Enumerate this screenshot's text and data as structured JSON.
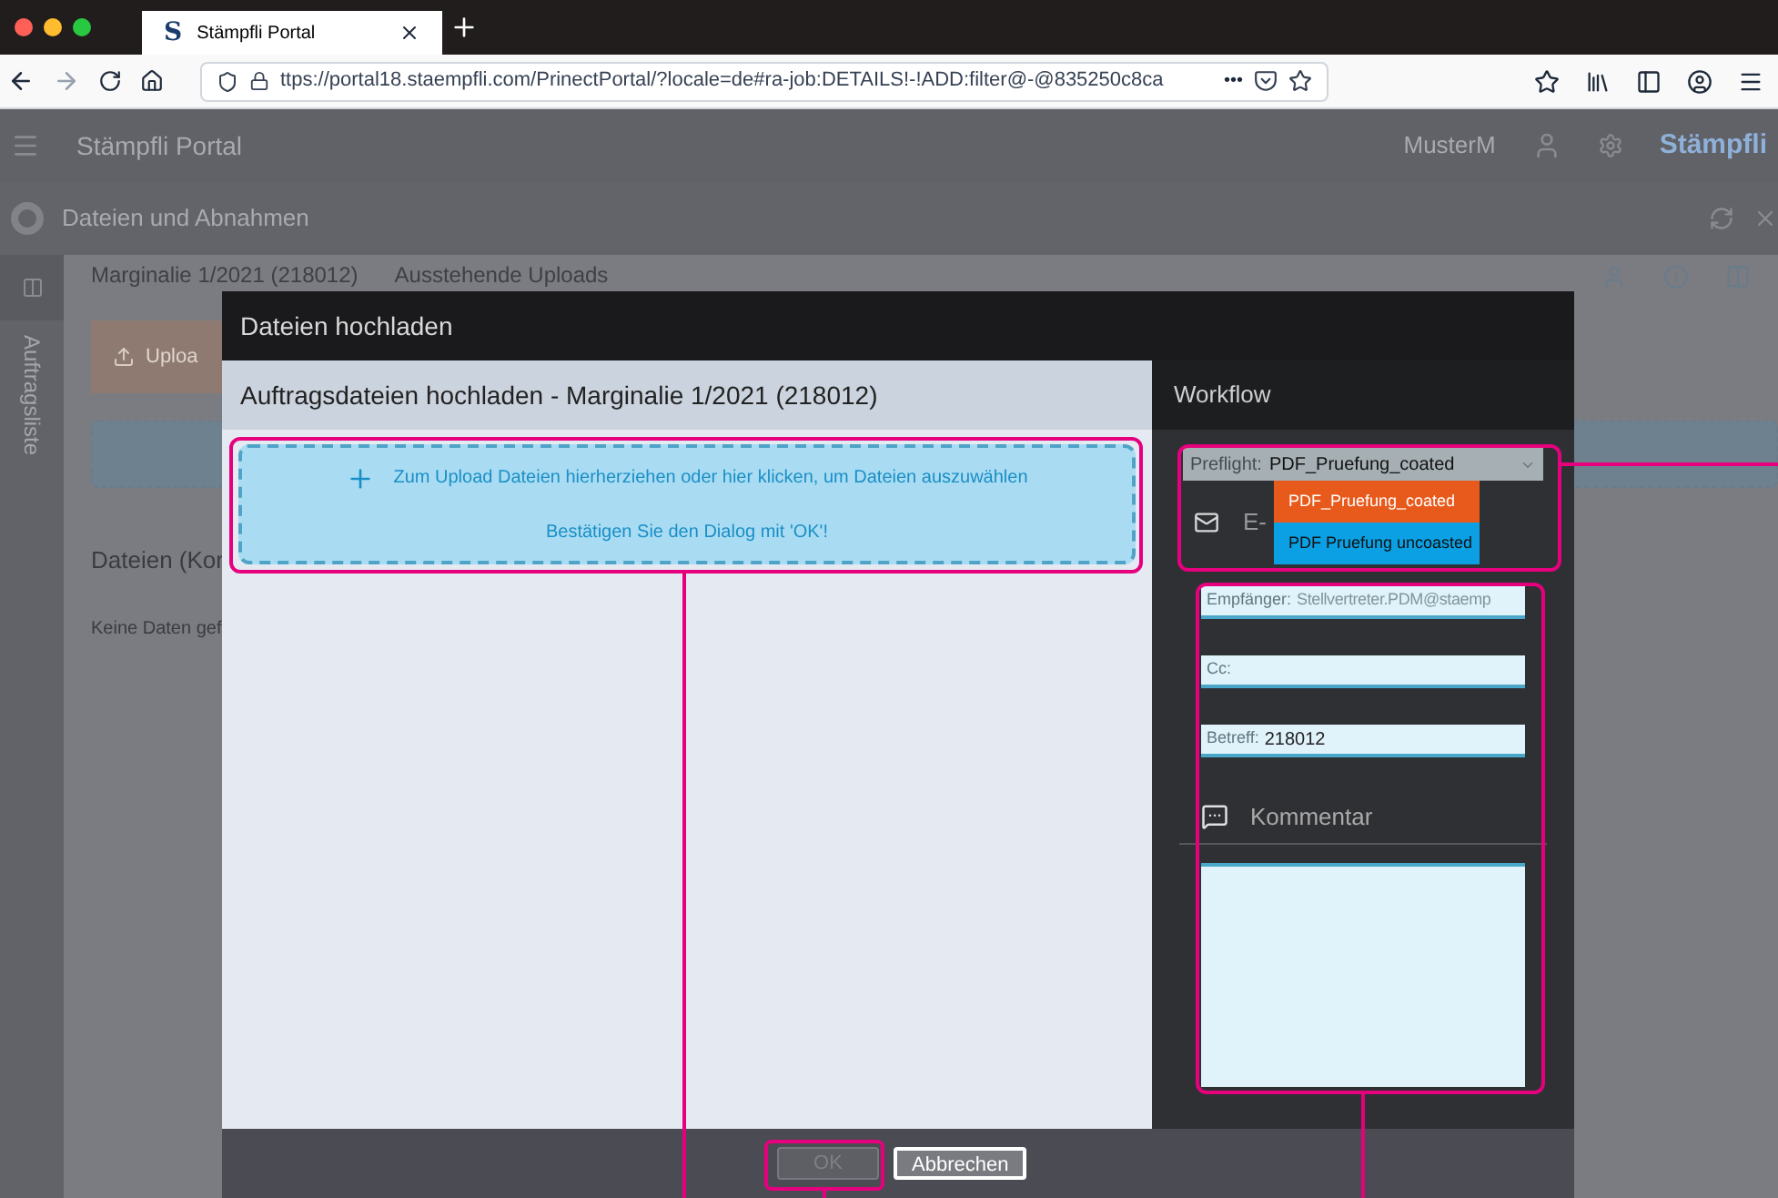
{
  "browser": {
    "tab_title": "Stämpfli Portal",
    "tab_icon": "S",
    "url": "ttps://portal18.staempfli.com/PrinectPortal/?locale=de#ra-job:DETAILS!-!ADD:filter@-@835250c8ca",
    "more": "•••"
  },
  "app": {
    "title": "Stämpfli Portal",
    "user": "MusterM",
    "logo": "Stämpfli",
    "section": "Dateien und Abnahmen",
    "sidebar_label": "Auftragsliste",
    "job": "Marginalie 1/2021 (218012)",
    "pending": "Ausstehende Uploads",
    "upload_button": "Uploa",
    "files_heading": "Dateien (Kor",
    "empty": "Keine Daten gef"
  },
  "dialog": {
    "title": "Dateien hochladen",
    "subtitle": "Auftragsdateien hochladen - Marginalie 1/2021 (218012)",
    "dropzone": {
      "text": "Zum Upload Dateien hierherziehen oder hier klicken, um Dateien auszuwählen",
      "hint": "Bestätigen Sie den Dialog mit 'OK'!"
    },
    "workflow": {
      "title": "Workflow",
      "preflight_label": "Preflight:",
      "preflight_value": "PDF_Pruefung_coated",
      "options": [
        {
          "label": "PDF_Pruefung_coated",
          "selected": true
        },
        {
          "label": "PDF Pruefung uncoasted",
          "selected": false
        }
      ],
      "email_label": "E-",
      "fields": [
        {
          "label": "Empfänger:",
          "placeholder": "Stellvertreter.PDM@staemp"
        },
        {
          "label": "Cc:"
        },
        {
          "label": "Betreff:",
          "value": "218012"
        }
      ],
      "comment_label": "Kommentar"
    },
    "buttons": [
      {
        "label": "OK",
        "disabled": true
      },
      {
        "label": "Abbrechen",
        "disabled": false
      }
    ]
  }
}
